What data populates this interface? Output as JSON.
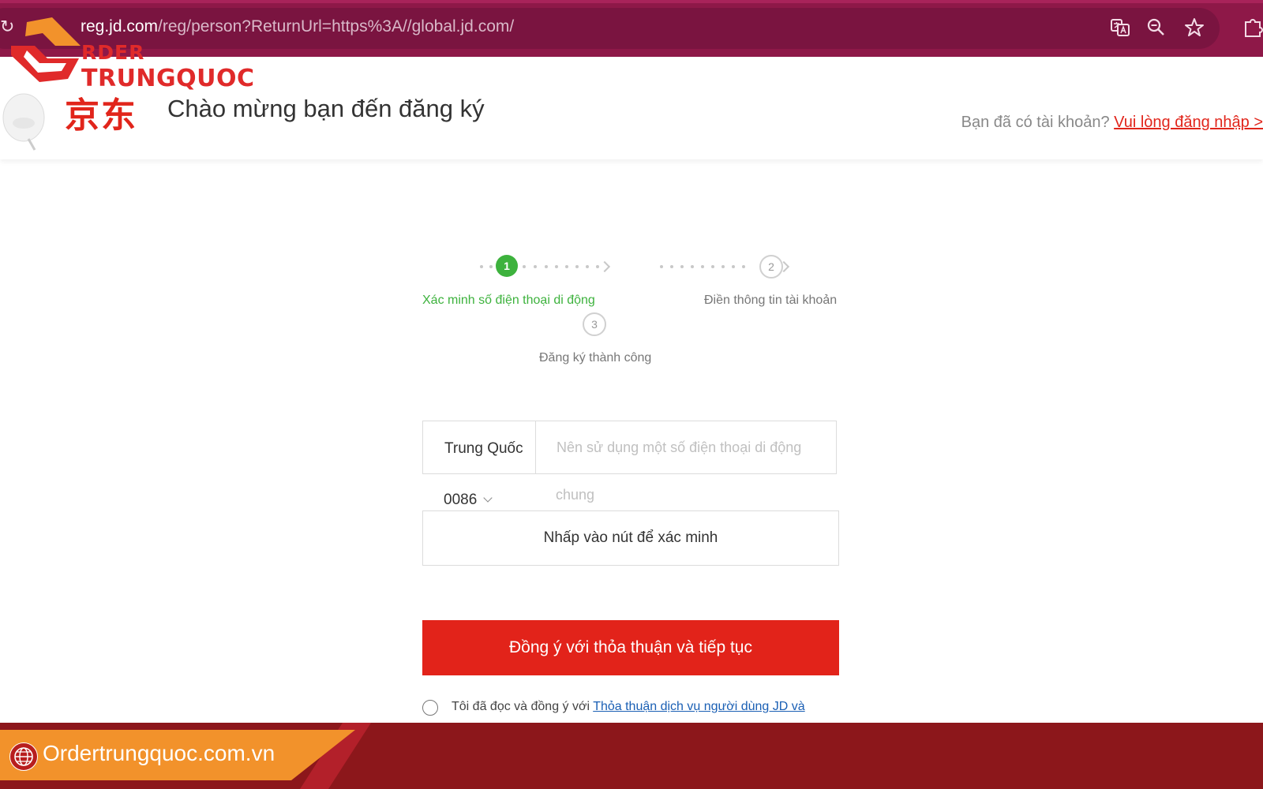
{
  "browser": {
    "url_host": "reg.jd.com",
    "url_path": "/reg/person?ReturnUrl=https%3A//global.jd.com/",
    "icons": [
      "reload-icon",
      "translate-icon",
      "zoom-icon",
      "bookmark-star-icon",
      "extensions-icon"
    ]
  },
  "watermark": {
    "line1": "RDER",
    "line2": "TRUNGQUOC"
  },
  "header": {
    "logo_text": "京东",
    "title": "Chào mừng bạn đến đăng ký",
    "login_prompt": "Bạn đã có tài khoản?",
    "login_link": "Vui lòng đăng nhập >"
  },
  "steps": [
    {
      "number": "1",
      "label": "Xác minh số điện thoại di động",
      "active": true
    },
    {
      "number": "2",
      "label": "Điền thông tin tài khoản",
      "active": false
    },
    {
      "number": "3",
      "label": "Đăng ký thành công",
      "active": false
    }
  ],
  "form": {
    "country_name": "Trung Quốc",
    "country_code": "0086",
    "phone_placeholder": "Nên sử dụng một số điện thoại di động",
    "phone_placeholder_wrap": "chung",
    "verify_button": "Nhấp vào nút để xác minh",
    "submit_button": "Đồng ý với thỏa thuận và tiếp tục",
    "agree_text": "Tôi đã đọc và đồng ý với",
    "agree_link": "Thỏa thuận dịch vụ người dùng JD và"
  },
  "footer": {
    "site": "Ordertrungquoc.com.vn"
  },
  "colors": {
    "browser_bar": "#8e1848",
    "jd_red": "#e1251b",
    "step_active": "#3db23d",
    "footer_band": "#8c171b",
    "footer_tab": "#f2922b"
  }
}
